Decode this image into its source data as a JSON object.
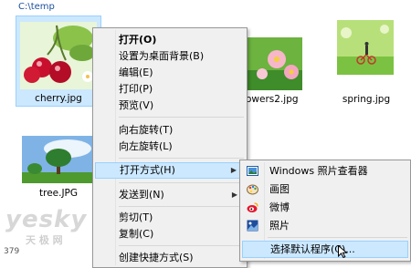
{
  "path": "C:\\temp",
  "files": [
    {
      "name": "cherry.jpg"
    },
    {
      "name": "owers2.jpg"
    },
    {
      "name": "spring.jpg"
    },
    {
      "name": "tree.JPG"
    }
  ],
  "status": "379",
  "watermark": {
    "main": "yesky",
    "sub": "天 极 网"
  },
  "context_menu": {
    "items": [
      {
        "label": "打开(O)"
      },
      {
        "label": "设置为桌面背景(B)"
      },
      {
        "label": "编辑(E)"
      },
      {
        "label": "打印(P)"
      },
      {
        "label": "预览(V)"
      },
      {
        "label": "向右旋转(T)"
      },
      {
        "label": "向左旋转(L)"
      },
      {
        "label": "打开方式(H)"
      },
      {
        "label": "发送到(N)"
      },
      {
        "label": "剪切(T)"
      },
      {
        "label": "复制(C)"
      },
      {
        "label": "创建快捷方式(S)"
      }
    ]
  },
  "open_with_menu": {
    "items": [
      {
        "label": "Windows 照片查看器",
        "icon": "photo-viewer-icon"
      },
      {
        "label": "画图",
        "icon": "paint-icon"
      },
      {
        "label": "微博",
        "icon": "weibo-icon"
      },
      {
        "label": "照片",
        "icon": "photos-icon"
      },
      {
        "label": "选择默认程序(C)..."
      }
    ]
  },
  "colors": {
    "selection": "#cce8ff",
    "selection_border": "#99d1ff",
    "menu_bg": "#f0f0f0"
  }
}
